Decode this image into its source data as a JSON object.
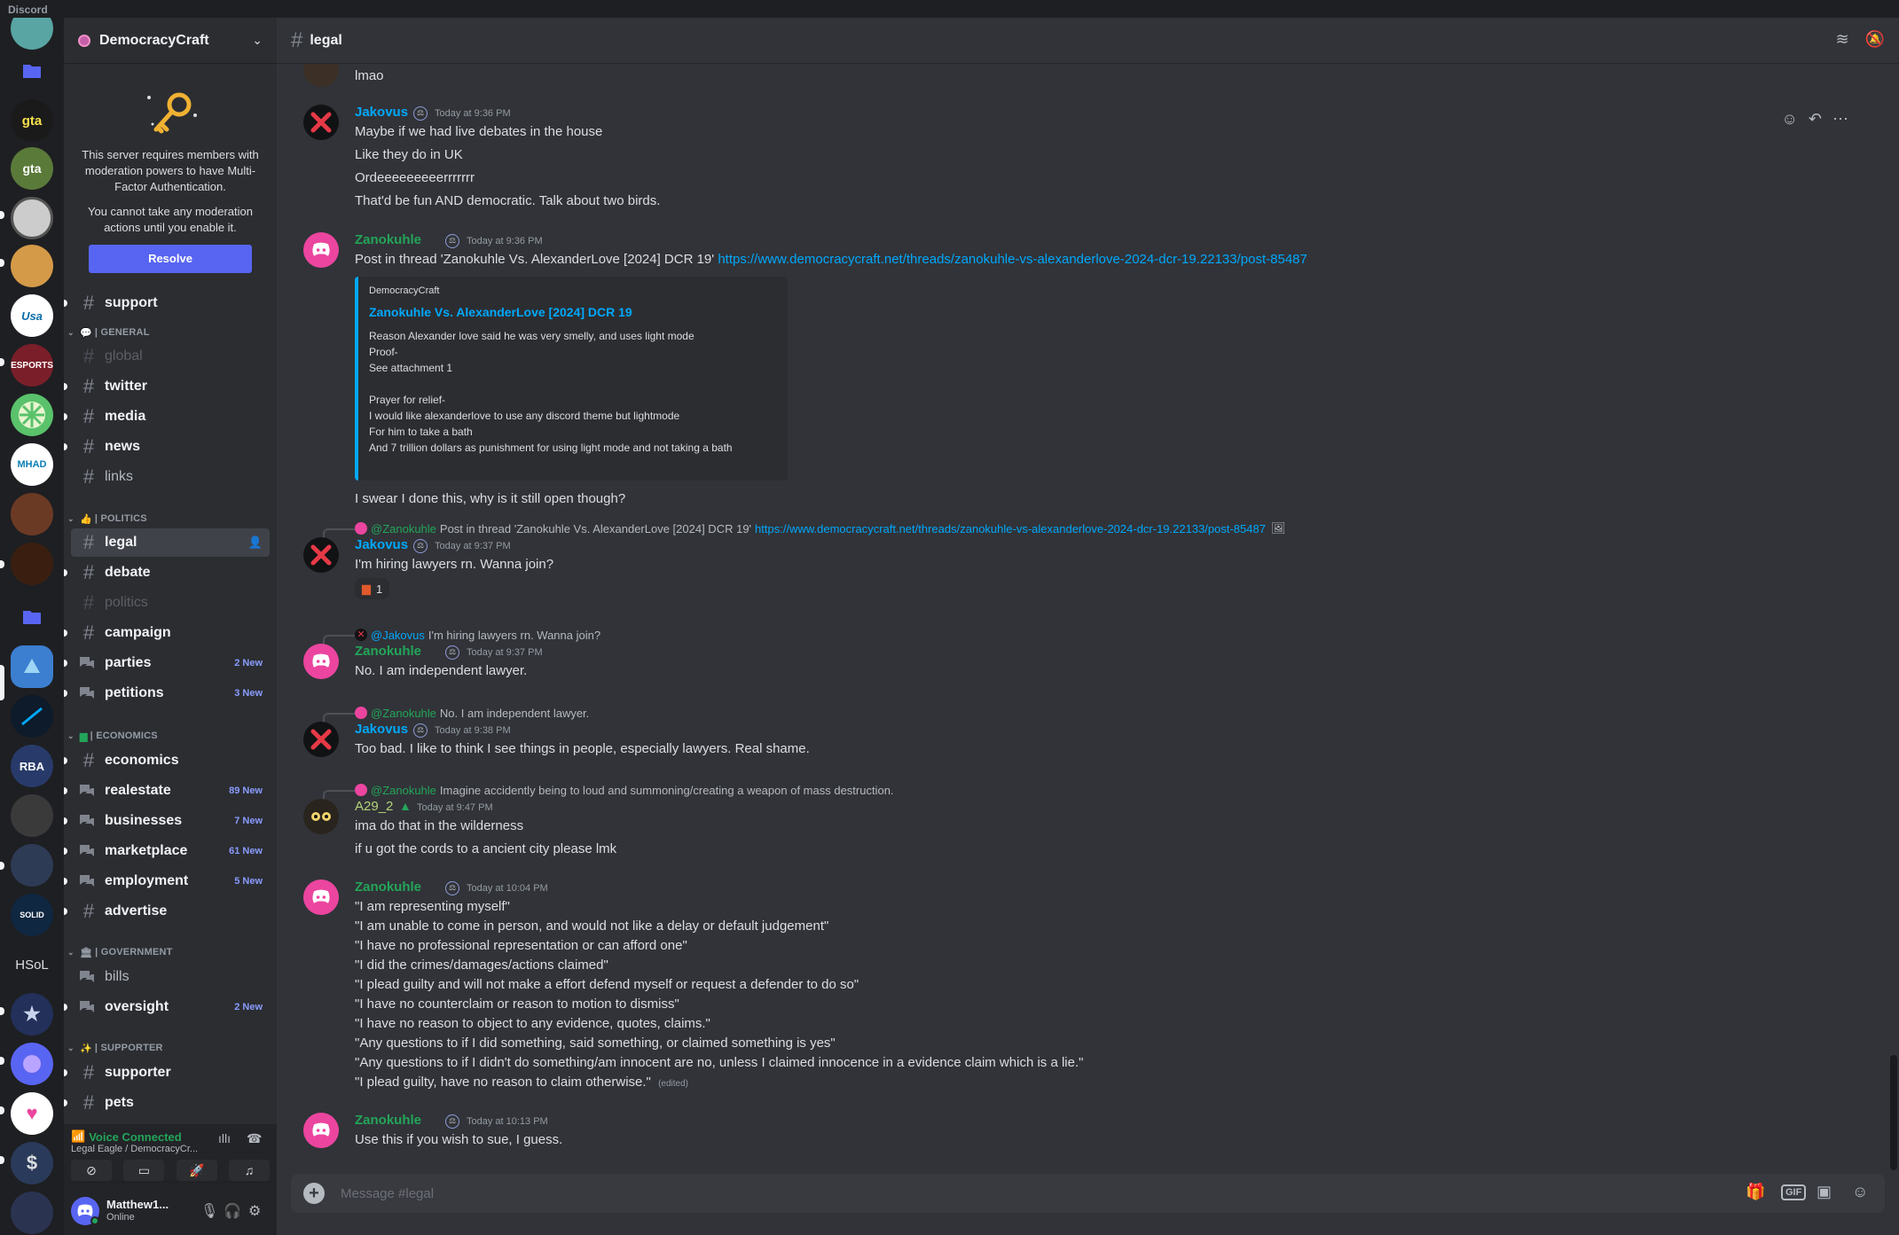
{
  "app": {
    "name": "Discord"
  },
  "server": {
    "name": "DemocracyCraft",
    "mfa_text": "This server requires members with moderation powers to have Multi-Factor Authentication.",
    "mfa_text2": "You cannot take any moderation actions until you enable it.",
    "resolve_label": "Resolve"
  },
  "rail": {
    "hsol": "HSoL",
    "rba": "RBA",
    "solid": "SOLID"
  },
  "categories": {
    "general": "| GENERAL",
    "politics": "| POLITICS",
    "economics": "| ECONOMICS",
    "government": "| GOVERNMENT",
    "supporter": "| SUPPORTER"
  },
  "channels": {
    "support": "support",
    "global": "global",
    "twitter": "twitter",
    "media": "media",
    "news": "news",
    "links": "links",
    "legal": "legal",
    "debate": "debate",
    "politics": "politics",
    "campaign": "campaign",
    "parties": "parties",
    "parties_badge": "2 New",
    "petitions": "petitions",
    "petitions_badge": "3 New",
    "economics": "economics",
    "realestate": "realestate",
    "realestate_badge": "89 New",
    "businesses": "businesses",
    "businesses_badge": "7 New",
    "marketplace": "marketplace",
    "marketplace_badge": "61 New",
    "employment": "employment",
    "employment_badge": "5 New",
    "advertise": "advertise",
    "bills": "bills",
    "oversight": "oversight",
    "oversight_badge": "2 New",
    "supporter": "supporter",
    "pets": "pets"
  },
  "voice": {
    "status": "Voice Connected",
    "location": "Legal Eagle / DemocracyCr..."
  },
  "user": {
    "name": "Matthew1...",
    "status": "Online"
  },
  "header": {
    "channel": "legal"
  },
  "messages": {
    "m0": {
      "line1": "lmao"
    },
    "m1": {
      "author": "Jakovus",
      "time": "Today at 9:36 PM",
      "l1": "Maybe if we had live debates in the house",
      "l2": "Like they do in UK",
      "l3": "Ordeeeeeeeeerrrrrrr",
      "l4": "That'd be fun AND democratic. Talk about two birds."
    },
    "m2": {
      "author": "Zanokuhle",
      "time": "Today at 9:36 PM",
      "text": "Post in thread 'Zanokuhle Vs. AlexanderLove [2024] DCR 19'",
      "link": "https://www.democracycraft.net/threads/zanokuhle-vs-alexanderlove-2024-dcr-19.22133/post-85487",
      "embed_provider": "DemocracyCraft",
      "embed_title": "Zanokuhle Vs. AlexanderLove [2024] DCR 19",
      "embed_desc": "Reason Alexander love said he was very smelly, and uses light mode\nProof-\nSee attachment 1\n\nPrayer for relief-\nI would like alexanderlove to use any discord theme but lightmode\nFor him to take a bath\nAnd 7 trillion dollars as punishment for using light mode and not taking a bath",
      "after": "I swear I done this, why is it still open though?"
    },
    "m3": {
      "reply_name": "@Zanokuhle",
      "reply_text": "Post in thread 'Zanokuhle Vs. AlexanderLove [2024] DCR 19'",
      "reply_link": "https://www.democracycraft.net/threads/zanokuhle-vs-alexanderlove-2024-dcr-19.22133/post-85487",
      "author": "Jakovus",
      "time": "Today at 9:37 PM",
      "text": "I'm hiring lawyers rn. Wanna join?",
      "reaction_count": "1"
    },
    "m4": {
      "reply_name": "@Jakovus",
      "reply_text": "I'm hiring lawyers rn. Wanna join?",
      "author": "Zanokuhle",
      "time": "Today at 9:37 PM",
      "text": "No. I am independent lawyer."
    },
    "m5": {
      "reply_name": "@Zanokuhle",
      "reply_text": "No. I am independent lawyer.",
      "author": "Jakovus",
      "time": "Today at 9:38 PM",
      "text": "Too bad. I like to think I see things in people, especially lawyers. Real shame."
    },
    "m6": {
      "reply_name": "@Zanokuhle",
      "reply_text": "Imagine accidently being to loud and summoning/creating a weapon of mass destruction.",
      "author": "A29_2",
      "time": "Today at 9:47 PM",
      "l1": "ima do that in the wilderness",
      "l2": "if u got the cords to a ancient city please lmk"
    },
    "m7": {
      "author": "Zanokuhle",
      "time": "Today at 10:04 PM",
      "lines": [
        "\"I am representing myself\"",
        "\"I am unable to come in person, and would not like a delay or default judgement\"",
        "\"I have no professional representation or can afford one\"",
        "\"I did the crimes/damages/actions claimed\"",
        "\"I plead guilty and will not make a effort defend myself or request a defender to do so\"",
        "\"I have no counterclaim or reason to motion to dismiss\"",
        "\"I have no reason to object to any evidence, quotes, claims.\"",
        "\"Any questions to if I did something, said something, or claimed something is yes\"",
        "\"Any questions to if I didn't do something/am innocent are no, unless I claimed innocence in a evidence claim which is a lie.\"",
        "\"I plead guilty, have no reason to claim otherwise.\""
      ],
      "edited": "(edited)"
    },
    "m8": {
      "author": "Zanokuhle",
      "time": "Today at 10:13 PM",
      "text": "Use this if you wish to sue, I guess."
    }
  },
  "composer": {
    "placeholder": "Message #legal"
  },
  "colors": {
    "blurple": "#5865f2",
    "green_name": "#23a559",
    "blue_name": "#00a8fc",
    "a29_name": "#b5d47b"
  }
}
